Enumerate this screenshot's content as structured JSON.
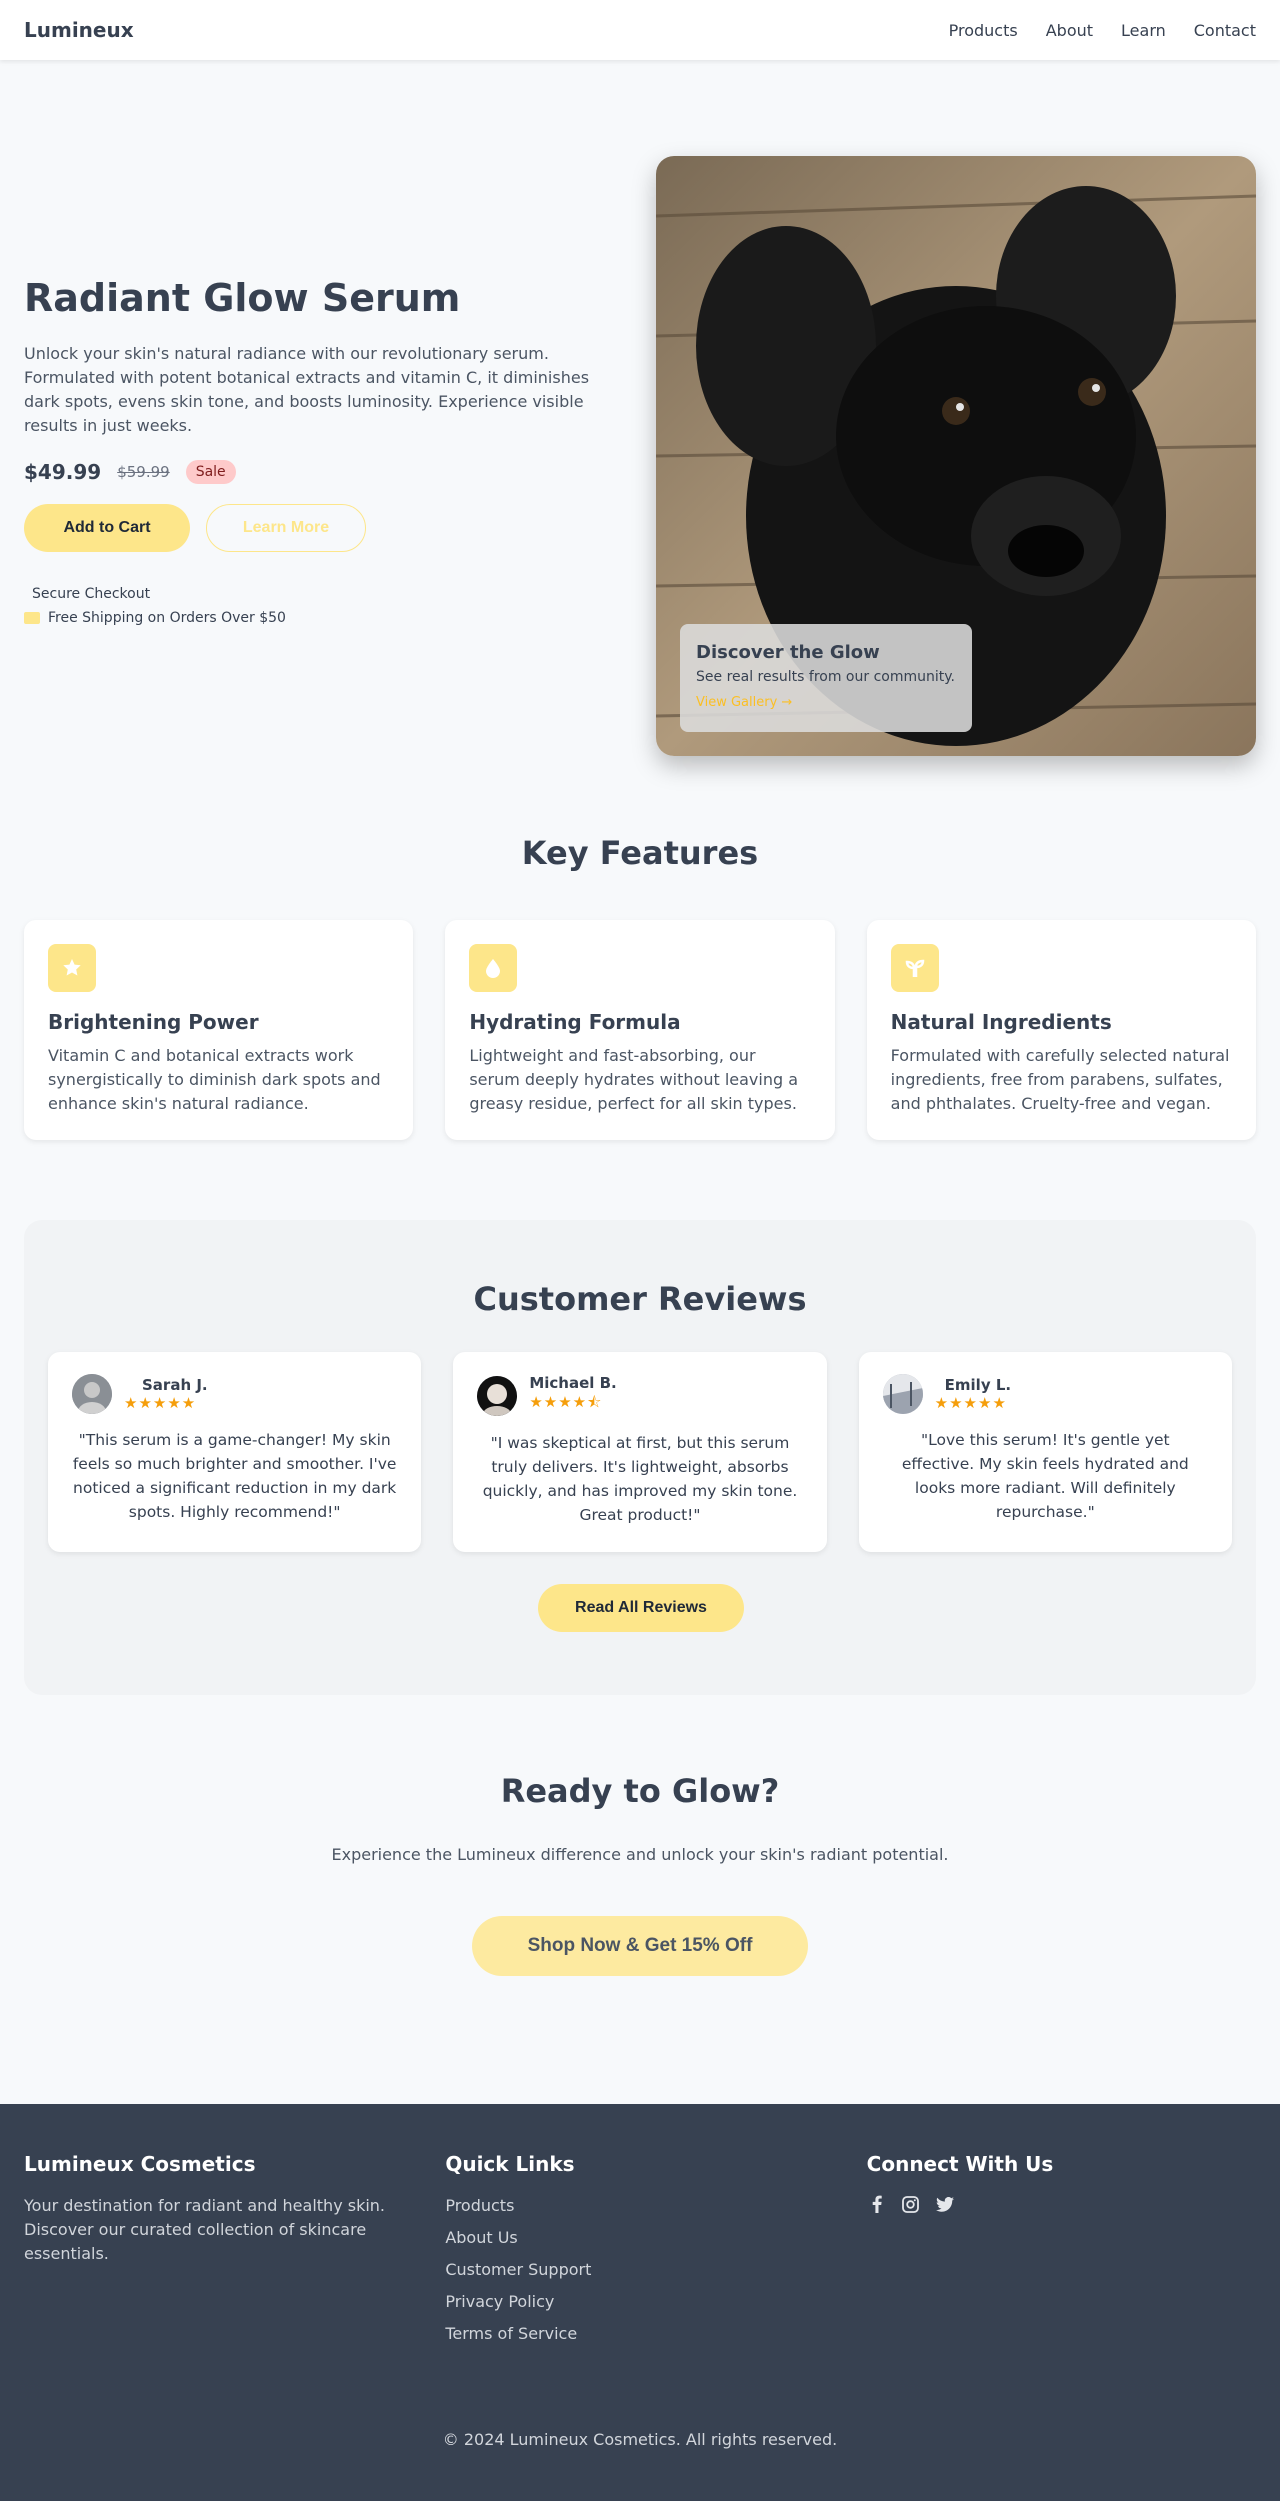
{
  "nav": {
    "brand": "Lumineux",
    "links": [
      "Products",
      "About",
      "Learn",
      "Contact"
    ]
  },
  "hero": {
    "title": "Radiant Glow Serum",
    "description": "Unlock your skin's natural radiance with our revolutionary serum. Formulated with potent botanical extracts and vitamin C, it diminishes dark spots, evens skin tone, and boosts luminosity. Experience visible results in just weeks.",
    "price": "$49.99",
    "old_price": "$59.99",
    "badge": "Sale",
    "add_to_cart": "Add to Cart",
    "learn_more": "Learn More",
    "trust_secure": "Secure Checkout",
    "trust_shipping": "Free Shipping on Orders Over $50",
    "overlay_title": "Discover the Glow",
    "overlay_sub": "See real results from our community.",
    "overlay_link": "View Gallery →"
  },
  "features": {
    "title": "Key Features",
    "items": [
      {
        "icon": "star-icon",
        "title": "Brightening Power",
        "desc": "Vitamin C and botanical extracts work synergistically to diminish dark spots and enhance skin's natural radiance."
      },
      {
        "icon": "droplet-icon",
        "title": "Hydrating Formula",
        "desc": "Lightweight and fast-absorbing, our serum deeply hydrates without leaving a greasy residue, perfect for all skin types."
      },
      {
        "icon": "seedling-icon",
        "title": "Natural Ingredients",
        "desc": "Formulated with carefully selected natural ingredients, free from parabens, sulfates, and phthalates. Cruelty-free and vegan."
      }
    ]
  },
  "reviews": {
    "title": "Customer Reviews",
    "items": [
      {
        "name": "Sarah J.",
        "stars": "★★★★★",
        "text": "\"This serum is a game-changer! My skin feels so much brighter and smoother. I've noticed a significant reduction in my dark spots. Highly recommend!\""
      },
      {
        "name": "Michael B.",
        "stars": "★★★★⯪",
        "text": "\"I was skeptical at first, but this serum truly delivers. It's lightweight, absorbs quickly, and has improved my skin tone. Great product!\""
      },
      {
        "name": "Emily L.",
        "stars": "★★★★★",
        "text": "\"Love this serum! It's gentle yet effective. My skin feels hydrated and looks more radiant. Will definitely repurchase.\""
      }
    ],
    "read_all": "Read All Reviews"
  },
  "cta": {
    "title": "Ready to Glow?",
    "desc": "Experience the Lumineux difference and unlock your skin's radiant potential.",
    "button": "Shop Now & Get 15% Off"
  },
  "footer": {
    "brand": "Lumineux Cosmetics",
    "about": "Your destination for radiant and healthy skin. Discover our curated collection of skincare essentials.",
    "links_title": "Quick Links",
    "links": [
      "Products",
      "About Us",
      "Customer Support",
      "Privacy Policy",
      "Terms of Service"
    ],
    "connect_title": "Connect With Us",
    "socials": [
      "facebook-icon",
      "instagram-icon",
      "twitter-icon"
    ],
    "copyright": "© 2024 Lumineux Cosmetics. All rights reserved."
  },
  "colors": {
    "accent": "#fde68a",
    "footer_bg": "#374151",
    "star": "#f59e0b"
  }
}
